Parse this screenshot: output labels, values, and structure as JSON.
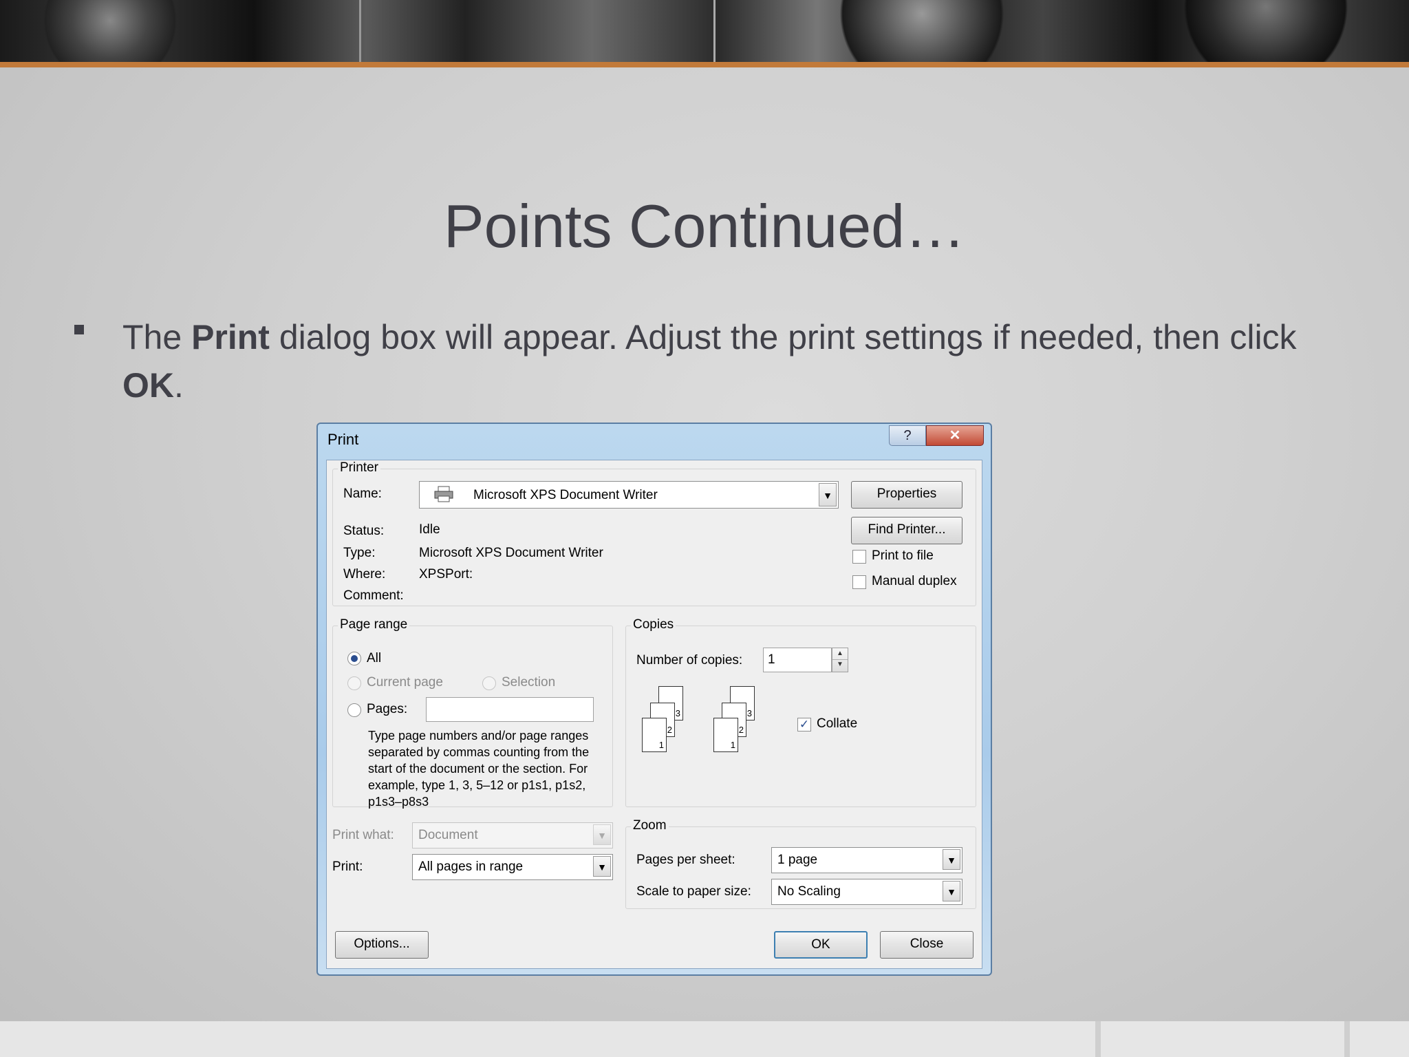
{
  "slide": {
    "title": "Points Continued…",
    "bullet": {
      "part1": "The ",
      "bold1": "Print",
      "part2": " dialog box will appear. Adjust the print settings if needed, then click ",
      "bold2": "OK",
      "part3": "."
    }
  },
  "dialog": {
    "title": "Print",
    "help_label": "?",
    "close_label": "✕",
    "printer_group": {
      "label": "Printer",
      "name_label": "Name:",
      "name_value": "Microsoft XPS Document Writer",
      "status_label": "Status:",
      "status_value": "Idle",
      "type_label": "Type:",
      "type_value": "Microsoft XPS Document Writer",
      "where_label": "Where:",
      "where_value": "XPSPort:",
      "comment_label": "Comment:",
      "properties_button": "Properties",
      "find_printer_button": "Find Printer...",
      "print_to_file_label": "Print to file",
      "print_to_file_checked": false,
      "manual_duplex_label": "Manual duplex",
      "manual_duplex_checked": false
    },
    "page_range": {
      "label": "Page range",
      "all_label": "All",
      "current_page_label": "Current page",
      "selection_label": "Selection",
      "pages_label": "Pages:",
      "pages_value": "",
      "selected": "All",
      "help_text": "Type page numbers and/or page ranges separated by commas counting from the start of the document or the section. For example, type 1, 3, 5–12 or p1s1, p1s2, p1s3–p8s3"
    },
    "copies": {
      "label": "Copies",
      "number_label": "Number of copies:",
      "number_value": "1",
      "collate_label": "Collate",
      "collate_checked": true,
      "stack_numbers": [
        "3",
        "2",
        "1"
      ]
    },
    "print_what_label": "Print what:",
    "print_what_value": "Document",
    "print_label": "Print:",
    "print_value": "All pages in range",
    "zoom": {
      "label": "Zoom",
      "pages_per_sheet_label": "Pages per sheet:",
      "pages_per_sheet_value": "1 page",
      "scale_label": "Scale to paper size:",
      "scale_value": "No Scaling"
    },
    "options_button": "Options...",
    "ok_button": "OK",
    "close_button": "Close"
  },
  "colors": {
    "accent_line": "#c27a3a",
    "title_text": "#404048",
    "dialog_frame": "#a9cbea",
    "close_button": "#c24a35"
  }
}
